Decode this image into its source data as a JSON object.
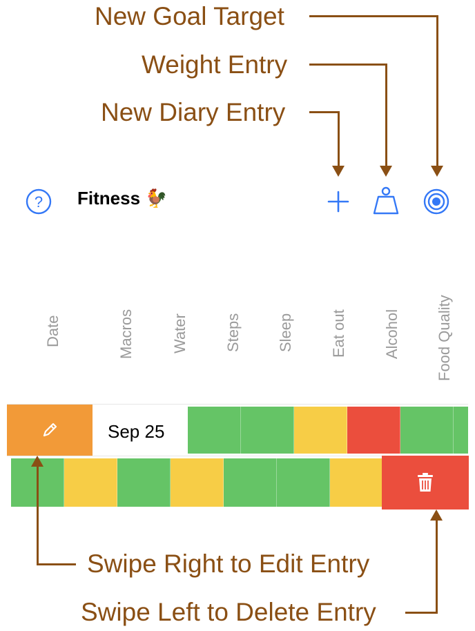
{
  "annotations": {
    "goal": "New Goal Target",
    "weight": "Weight Entry",
    "diary": "New Diary Entry",
    "edit": "Swipe Right to Edit Entry",
    "delete": "Swipe Left to Delete Entry"
  },
  "navbar": {
    "title": "Fitness 🐓",
    "icons": [
      "question-circle-icon",
      "plus-icon",
      "weight-scale-icon",
      "target-icon"
    ]
  },
  "columns": [
    "Date",
    "Macros",
    "Water",
    "Steps",
    "Sleep",
    "Eat out",
    "Alcohol",
    "Food Quality"
  ],
  "rows": [
    {
      "date": "Sep 25",
      "cells": [
        "green",
        "green",
        "yellow",
        "red",
        "green",
        "green"
      ],
      "swipe_action": "edit"
    },
    {
      "date": "",
      "cells": [
        "green",
        "yellow",
        "green",
        "yellow",
        "green",
        "green",
        "yellow"
      ],
      "swipe_action": "delete"
    }
  ],
  "colors": {
    "annotation": "#8a4f14",
    "accent": "#3478f6",
    "green": "#65c466",
    "yellow": "#f7cd46",
    "red": "#eb4e3d",
    "orange": "#f29a38",
    "header_text": "#9a9a9a"
  }
}
